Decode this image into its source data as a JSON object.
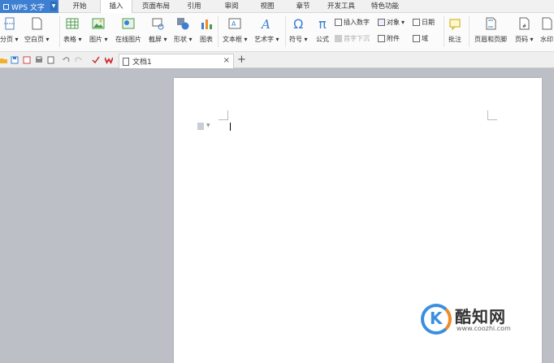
{
  "app": {
    "name": "WPS 文字"
  },
  "menu": {
    "tabs": [
      {
        "label": "开始"
      },
      {
        "label": "插入",
        "active": true
      },
      {
        "label": "页面布局"
      },
      {
        "label": "引用"
      },
      {
        "label": "审阅"
      },
      {
        "label": "视图"
      },
      {
        "label": "章节"
      },
      {
        "label": "开发工具"
      },
      {
        "label": "特色功能"
      }
    ]
  },
  "ribbon": {
    "fenye": "分页",
    "blank_page": "空白页",
    "table": "表格",
    "picture": "图片",
    "online_picture": "在线图片",
    "screenshot": "截屏",
    "shape": "形状",
    "chart": "图表",
    "textbox": "文本框",
    "wordart": "艺术字",
    "symbol": "符号",
    "formula": "公式",
    "insert_number": "插入数字",
    "object": "对象",
    "date": "日期",
    "first_letter_sink": "首字下沉",
    "attachment": "附件",
    "field": "域",
    "comment": "批注",
    "header_footer": "页眉和页脚",
    "page_number": "页码",
    "watermark": "水印"
  },
  "tabbar": {
    "document_name": "文档1",
    "close": "×",
    "new_tab": "+"
  },
  "watermark_logo": {
    "title": "酷知网",
    "url": "www.coozhi.com"
  },
  "colors": {
    "accent": "#3d7fd1",
    "workspace": "#bdbfc6"
  }
}
